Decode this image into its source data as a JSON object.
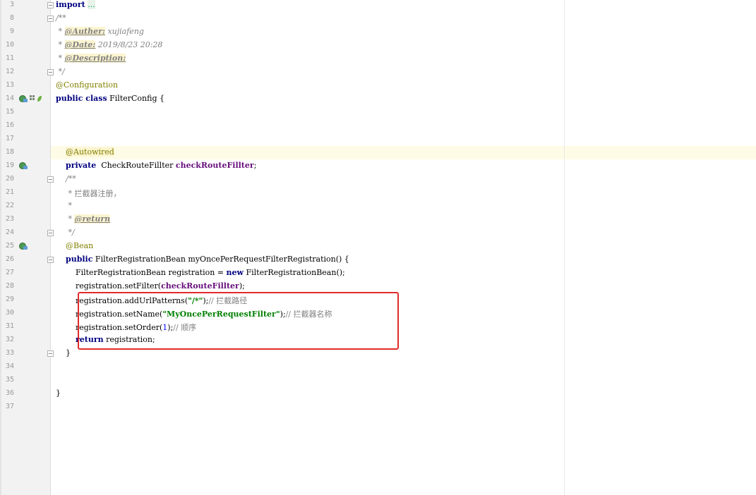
{
  "editor": {
    "lines": [
      {
        "n": "3",
        "segments": [
          {
            "t": "import",
            "c": "kw"
          },
          {
            "t": " ",
            "c": ""
          },
          {
            "t": "...",
            "c": "ellipsis"
          }
        ]
      },
      {
        "n": "8",
        "segments": [
          {
            "t": "/**",
            "c": "cmt"
          }
        ]
      },
      {
        "n": "9",
        "segments": [
          {
            "t": " * ",
            "c": "cmt"
          },
          {
            "t": "@Auther:",
            "c": "tag"
          },
          {
            "t": " xujiafeng",
            "c": "cmt"
          }
        ]
      },
      {
        "n": "10",
        "segments": [
          {
            "t": " * ",
            "c": "cmt"
          },
          {
            "t": "@Date:",
            "c": "tag"
          },
          {
            "t": " 2019/8/23 20:28",
            "c": "cmt"
          }
        ]
      },
      {
        "n": "11",
        "segments": [
          {
            "t": " * ",
            "c": "cmt"
          },
          {
            "t": "@Description:",
            "c": "tag"
          }
        ]
      },
      {
        "n": "12",
        "segments": [
          {
            "t": " */",
            "c": "cmt"
          }
        ]
      },
      {
        "n": "13",
        "segments": [
          {
            "t": "@Configuration",
            "c": "ann"
          }
        ]
      },
      {
        "n": "14",
        "segments": [
          {
            "t": "public class",
            "c": "kw"
          },
          {
            "t": " FilterConfig {",
            "c": ""
          }
        ]
      },
      {
        "n": "15",
        "segments": []
      },
      {
        "n": "16",
        "segments": []
      },
      {
        "n": "17",
        "segments": []
      },
      {
        "n": "18",
        "segments": [
          {
            "t": "    ",
            "c": ""
          },
          {
            "t": "@Autowired",
            "c": "ann ann-bg"
          }
        ]
      },
      {
        "n": "19",
        "segments": [
          {
            "t": "    ",
            "c": ""
          },
          {
            "t": "private",
            "c": "kw"
          },
          {
            "t": "  CheckRouteFillter ",
            "c": ""
          },
          {
            "t": "checkRouteFillter",
            "c": "field"
          },
          {
            "t": ";",
            "c": ""
          }
        ]
      },
      {
        "n": "20",
        "segments": [
          {
            "t": "    ",
            "c": ""
          },
          {
            "t": "/**",
            "c": "cmt"
          }
        ]
      },
      {
        "n": "21",
        "segments": [
          {
            "t": "     * 拦截器注册，",
            "c": "cmt-plain"
          }
        ]
      },
      {
        "n": "22",
        "segments": [
          {
            "t": "     *",
            "c": "cmt"
          }
        ]
      },
      {
        "n": "23",
        "segments": [
          {
            "t": "     * ",
            "c": "cmt"
          },
          {
            "t": "@return",
            "c": "tag"
          }
        ]
      },
      {
        "n": "24",
        "segments": [
          {
            "t": "     */",
            "c": "cmt"
          }
        ]
      },
      {
        "n": "25",
        "segments": [
          {
            "t": "    ",
            "c": ""
          },
          {
            "t": "@Bean",
            "c": "ann"
          }
        ]
      },
      {
        "n": "26",
        "segments": [
          {
            "t": "    ",
            "c": ""
          },
          {
            "t": "public",
            "c": "kw"
          },
          {
            "t": " FilterRegistrationBean myOncePerRequestFilterRegistration() {",
            "c": ""
          }
        ]
      },
      {
        "n": "27",
        "segments": [
          {
            "t": "        FilterRegistrationBean registration = ",
            "c": ""
          },
          {
            "t": "new",
            "c": "kw"
          },
          {
            "t": " FilterRegistrationBean();",
            "c": ""
          }
        ]
      },
      {
        "n": "28",
        "segments": [
          {
            "t": "        registration.setFilter(",
            "c": ""
          },
          {
            "t": "checkRouteFillter",
            "c": "field"
          },
          {
            "t": ");",
            "c": ""
          }
        ]
      },
      {
        "n": "29",
        "segments": [
          {
            "t": "        registration.addUrlPatterns(",
            "c": ""
          },
          {
            "t": "\"/*\"",
            "c": "str"
          },
          {
            "t": ");",
            "c": ""
          },
          {
            "t": "// 拦截路径",
            "c": "cmt-plain"
          }
        ]
      },
      {
        "n": "30",
        "segments": [
          {
            "t": "        registration.setName(",
            "c": ""
          },
          {
            "t": "\"MyOncePerRequestFilter\"",
            "c": "str"
          },
          {
            "t": ");",
            "c": ""
          },
          {
            "t": "// 拦截器名称",
            "c": "cmt-plain"
          }
        ]
      },
      {
        "n": "31",
        "segments": [
          {
            "t": "        registration.setOrder(",
            "c": ""
          },
          {
            "t": "1",
            "c": "num"
          },
          {
            "t": ");",
            "c": ""
          },
          {
            "t": "// 顺序",
            "c": "cmt-plain"
          }
        ]
      },
      {
        "n": "32",
        "segments": [
          {
            "t": "        ",
            "c": ""
          },
          {
            "t": "return",
            "c": "kw"
          },
          {
            "t": " registration;",
            "c": ""
          }
        ]
      },
      {
        "n": "33",
        "segments": [
          {
            "t": "    }",
            "c": ""
          }
        ]
      },
      {
        "n": "34",
        "segments": []
      },
      {
        "n": "35",
        "segments": []
      },
      {
        "n": "36",
        "segments": [
          {
            "t": "}",
            "c": ""
          }
        ]
      },
      {
        "n": "37",
        "segments": []
      }
    ]
  },
  "gutter_icons": [
    {
      "line": "14",
      "icons": [
        "spring-bean-icon",
        "bean-grid-icon",
        "spring-leaf-icon"
      ]
    },
    {
      "line": "19",
      "icons": [
        "autowired-bean-icon"
      ]
    },
    {
      "line": "25",
      "icons": [
        "bean-definition-icon"
      ]
    }
  ],
  "fold_lines": [
    "3",
    "8",
    "12",
    "20",
    "24",
    "26",
    "33"
  ],
  "colors": {
    "keyword": "#000080",
    "annotation": "#808000",
    "comment": "#808080",
    "string": "#008000",
    "field": "#660e7a",
    "number": "#0000ff",
    "highlight_box": "#e02b2b",
    "current_line": "#fefce6"
  }
}
